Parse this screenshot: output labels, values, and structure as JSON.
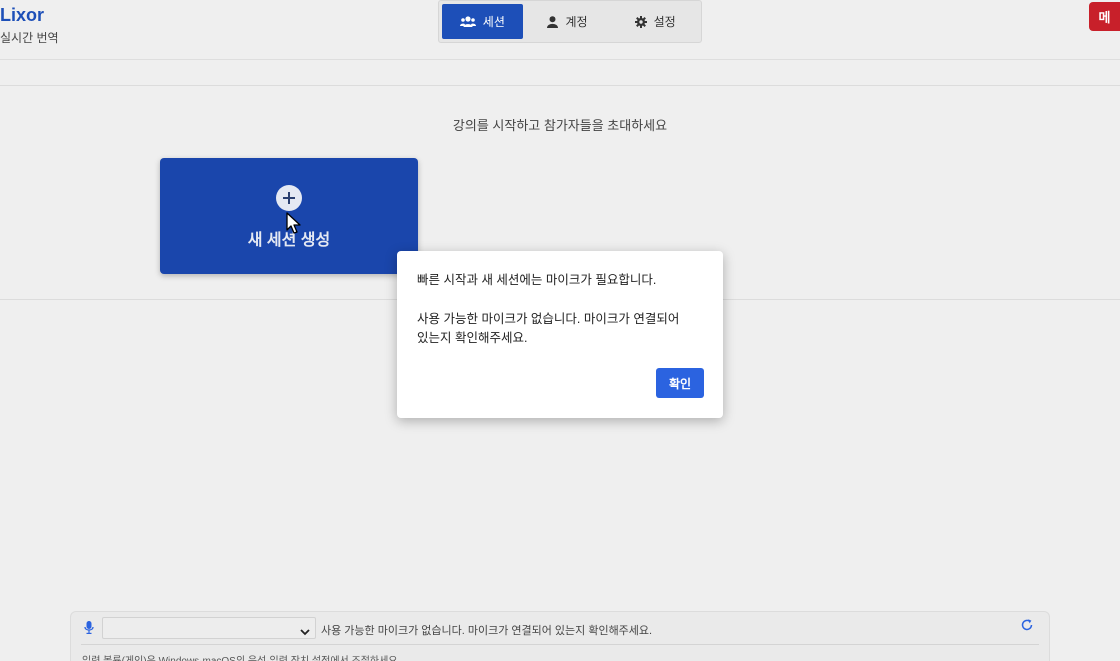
{
  "brand": {
    "title": "Lixor",
    "subtitle": "실시간 번역"
  },
  "tabs": [
    {
      "label": "세션",
      "icon": "users-icon",
      "active": true
    },
    {
      "label": "계정",
      "icon": "user-icon",
      "active": false
    },
    {
      "label": "설정",
      "icon": "gear-icon",
      "active": false
    }
  ],
  "avatar": {
    "initial": "메",
    "color": "#c8202a"
  },
  "main": {
    "prompt": "강의를 시작하고 참가자들을 초대하세요",
    "new_session_label": "새 세션 생성",
    "card_color": "#1a46ac"
  },
  "dialog": {
    "line1": "빠른 시작과 새 세션에는 마이크가 필요합니다.",
    "line2": "사용 가능한 마이크가 없습니다. 마이크가 연결되어",
    "line3": "있는지 확인해주세요.",
    "confirm_label": "확인",
    "confirm_color": "#2b63e0"
  },
  "mic_bar": {
    "selected_value": "",
    "status": "사용 가능한 마이크가 없습니다. 마이크가 연결되어 있는지 확인해주세요.",
    "hint": "입력 볼륨(게인)은 Windows·macOS의 음성·입력 장치 설정에서 조절하세요."
  },
  "colors": {
    "accent": "#1d4fb8",
    "avatar": "#c8202a",
    "button": "#2b63e0"
  }
}
